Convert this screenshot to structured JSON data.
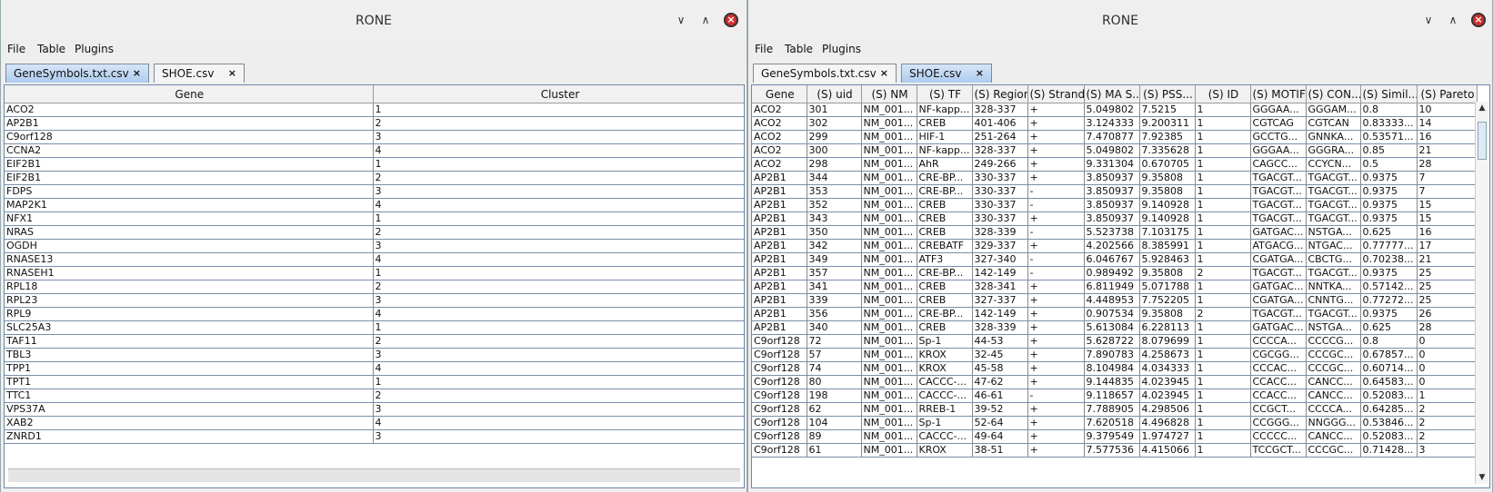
{
  "windows": [
    {
      "title": "RONE",
      "menu": [
        "File",
        "Table",
        "Plugins"
      ],
      "tabs": [
        {
          "label": "GeneSymbols.txt.csv",
          "selected": true
        },
        {
          "label": "SHOE.csv",
          "selected": false
        }
      ],
      "columns": [
        "Gene",
        "Cluster"
      ],
      "rows": [
        [
          "ACO2",
          "1"
        ],
        [
          "AP2B1",
          "2"
        ],
        [
          "C9orf128",
          "3"
        ],
        [
          "CCNA2",
          "4"
        ],
        [
          "EIF2B1",
          "1"
        ],
        [
          "EIF2B1",
          "2"
        ],
        [
          "FDPS",
          "3"
        ],
        [
          "MAP2K1",
          "4"
        ],
        [
          "NFX1",
          "1"
        ],
        [
          "NRAS",
          "2"
        ],
        [
          "OGDH",
          "3"
        ],
        [
          "RNASE13",
          "4"
        ],
        [
          "RNASEH1",
          "1"
        ],
        [
          "RPL18",
          "2"
        ],
        [
          "RPL23",
          "3"
        ],
        [
          "RPL9",
          "4"
        ],
        [
          "SLC25A3",
          "1"
        ],
        [
          "TAF11",
          "2"
        ],
        [
          "TBL3",
          "3"
        ],
        [
          "TPP1",
          "4"
        ],
        [
          "TPT1",
          "1"
        ],
        [
          "TTC1",
          "2"
        ],
        [
          "VPS37A",
          "3"
        ],
        [
          "XAB2",
          "4"
        ],
        [
          "ZNRD1",
          "3"
        ]
      ]
    },
    {
      "title": "RONE",
      "menu": [
        "File",
        "Table",
        "Plugins"
      ],
      "tabs": [
        {
          "label": "GeneSymbols.txt.csv",
          "selected": false
        },
        {
          "label": "SHOE.csv",
          "selected": true
        }
      ],
      "columns": [
        "Gene",
        "(S) uid",
        "(S) NM",
        "(S) TF",
        "(S) Region",
        "(S) Strand",
        "(S) MA S...",
        "(S) PSS...",
        "(S) ID",
        "(S) MOTIF",
        "(S) CON...",
        "(S) Simil...",
        "(S) Pareto"
      ],
      "rows": [
        [
          "ACO2",
          "301",
          "NM_001...",
          "NF-kapp...",
          "328-337",
          "+",
          "5.049802",
          "7.5215",
          "1",
          "GGGAA...",
          "GGGAM...",
          "0.8",
          "10"
        ],
        [
          "ACO2",
          "302",
          "NM_001...",
          "CREB",
          "401-406",
          "+",
          "3.124333",
          "9.200311",
          "1",
          "CGTCAG",
          "CGTCAN",
          "0.83333...",
          "14"
        ],
        [
          "ACO2",
          "299",
          "NM_001...",
          "HIF-1",
          "251-264",
          "+",
          "7.470877",
          "7.92385",
          "1",
          "GCCTG...",
          "GNNKA...",
          "0.53571...",
          "16"
        ],
        [
          "ACO2",
          "300",
          "NM_001...",
          "NF-kapp...",
          "328-337",
          "+",
          "5.049802",
          "7.335628",
          "1",
          "GGGAA...",
          "GGGRA...",
          "0.85",
          "21"
        ],
        [
          "ACO2",
          "298",
          "NM_001...",
          "AhR",
          "249-266",
          "+",
          "9.331304",
          "0.670705",
          "1",
          "CAGCC...",
          "CCYCN...",
          "0.5",
          "28"
        ],
        [
          "AP2B1",
          "344",
          "NM_001...",
          "CRE-BP...",
          "330-337",
          "+",
          "3.850937",
          "9.35808",
          "1",
          "TGACGT...",
          "TGACGT...",
          "0.9375",
          "7"
        ],
        [
          "AP2B1",
          "353",
          "NM_001...",
          "CRE-BP...",
          "330-337",
          "-",
          "3.850937",
          "9.35808",
          "1",
          "TGACGT...",
          "TGACGT...",
          "0.9375",
          "7"
        ],
        [
          "AP2B1",
          "352",
          "NM_001...",
          "CREB",
          "330-337",
          "-",
          "3.850937",
          "9.140928",
          "1",
          "TGACGT...",
          "TGACGT...",
          "0.9375",
          "15"
        ],
        [
          "AP2B1",
          "343",
          "NM_001...",
          "CREB",
          "330-337",
          "+",
          "3.850937",
          "9.140928",
          "1",
          "TGACGT...",
          "TGACGT...",
          "0.9375",
          "15"
        ],
        [
          "AP2B1",
          "350",
          "NM_001...",
          "CREB",
          "328-339",
          "-",
          "5.523738",
          "7.103175",
          "1",
          "GATGAC...",
          "NSTGA...",
          "0.625",
          "16"
        ],
        [
          "AP2B1",
          "342",
          "NM_001...",
          "CREBATF",
          "329-337",
          "+",
          "4.202566",
          "8.385991",
          "1",
          "ATGACG...",
          "NTGAC...",
          "0.77777...",
          "17"
        ],
        [
          "AP2B1",
          "349",
          "NM_001...",
          "ATF3",
          "327-340",
          "-",
          "6.046767",
          "5.928463",
          "1",
          "CGATGA...",
          "CBCTG...",
          "0.70238...",
          "21"
        ],
        [
          "AP2B1",
          "357",
          "NM_001...",
          "CRE-BP...",
          "142-149",
          "-",
          "0.989492",
          "9.35808",
          "2",
          "TGACGT...",
          "TGACGT...",
          "0.9375",
          "25"
        ],
        [
          "AP2B1",
          "341",
          "NM_001...",
          "CREB",
          "328-341",
          "+",
          "6.811949",
          "5.071788",
          "1",
          "GATGAC...",
          "NNTKA...",
          "0.57142...",
          "25"
        ],
        [
          "AP2B1",
          "339",
          "NM_001...",
          "CREB",
          "327-337",
          "+",
          "4.448953",
          "7.752205",
          "1",
          "CGATGA...",
          "CNNTG...",
          "0.77272...",
          "25"
        ],
        [
          "AP2B1",
          "356",
          "NM_001...",
          "CRE-BP...",
          "142-149",
          "+",
          "0.907534",
          "9.35808",
          "2",
          "TGACGT...",
          "TGACGT...",
          "0.9375",
          "26"
        ],
        [
          "AP2B1",
          "340",
          "NM_001...",
          "CREB",
          "328-339",
          "+",
          "5.613084",
          "6.228113",
          "1",
          "GATGAC...",
          "NSTGA...",
          "0.625",
          "28"
        ],
        [
          "C9orf128",
          "72",
          "NM_001...",
          "Sp-1",
          "44-53",
          "+",
          "5.628722",
          "8.079699",
          "1",
          "CCCCA...",
          "CCCCG...",
          "0.8",
          "0"
        ],
        [
          "C9orf128",
          "57",
          "NM_001...",
          "KROX",
          "32-45",
          "+",
          "7.890783",
          "4.258673",
          "1",
          "CGCGG...",
          "CCCGC...",
          "0.67857...",
          "0"
        ],
        [
          "C9orf128",
          "74",
          "NM_001...",
          "KROX",
          "45-58",
          "+",
          "8.104984",
          "4.034333",
          "1",
          "CCCAC...",
          "CCCGC...",
          "0.60714...",
          "0"
        ],
        [
          "C9orf128",
          "80",
          "NM_001...",
          "CACCC-...",
          "47-62",
          "+",
          "9.144835",
          "4.023945",
          "1",
          "CCACC...",
          "CANCC...",
          "0.64583...",
          "0"
        ],
        [
          "C9orf128",
          "198",
          "NM_001...",
          "CACCC-...",
          "46-61",
          "-",
          "9.118657",
          "4.023945",
          "1",
          "CCACC...",
          "CANCC...",
          "0.52083...",
          "1"
        ],
        [
          "C9orf128",
          "62",
          "NM_001...",
          "RREB-1",
          "39-52",
          "+",
          "7.788905",
          "4.298506",
          "1",
          "CCGCT...",
          "CCCCA...",
          "0.64285...",
          "2"
        ],
        [
          "C9orf128",
          "104",
          "NM_001...",
          "Sp-1",
          "52-64",
          "+",
          "7.620518",
          "4.496828",
          "1",
          "CCGGG...",
          "NNGGG...",
          "0.53846...",
          "2"
        ],
        [
          "C9orf128",
          "89",
          "NM_001...",
          "CACCC-...",
          "49-64",
          "+",
          "9.379549",
          "1.974727",
          "1",
          "CCCCC...",
          "CANCC...",
          "0.52083...",
          "2"
        ],
        [
          "C9orf128",
          "61",
          "NM_001...",
          "KROX",
          "38-51",
          "+",
          "7.577536",
          "4.415066",
          "1",
          "TCCGCT...",
          "CCCGC...",
          "0.71428...",
          "3"
        ]
      ]
    }
  ]
}
